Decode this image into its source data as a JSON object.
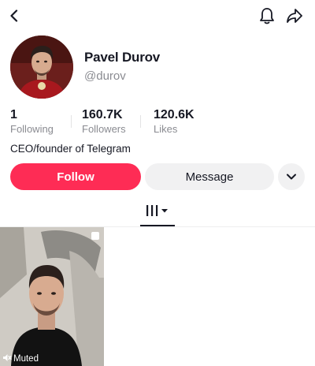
{
  "profile": {
    "display_name": "Pavel Durov",
    "username": "@durov",
    "bio": "CEO/founder of Telegram"
  },
  "stats": {
    "following": {
      "value": "1",
      "label": "Following"
    },
    "followers": {
      "value": "160.7K",
      "label": "Followers"
    },
    "likes": {
      "value": "120.6K",
      "label": "Likes"
    }
  },
  "actions": {
    "follow_label": "Follow",
    "message_label": "Message"
  },
  "videos": [
    {
      "muted_label": "Muted"
    }
  ],
  "icons": {
    "back": "back-arrow-icon",
    "notification": "bell-icon",
    "share": "share-arrow-icon",
    "more": "chevron-down-icon",
    "videos_tab": "grid-bars-icon",
    "muted": "speaker-muted-icon"
  },
  "colors": {
    "accent": "#fe2c55",
    "secondary_button": "#f1f1f2",
    "muted_text": "#8a8b91",
    "text": "#161823"
  }
}
